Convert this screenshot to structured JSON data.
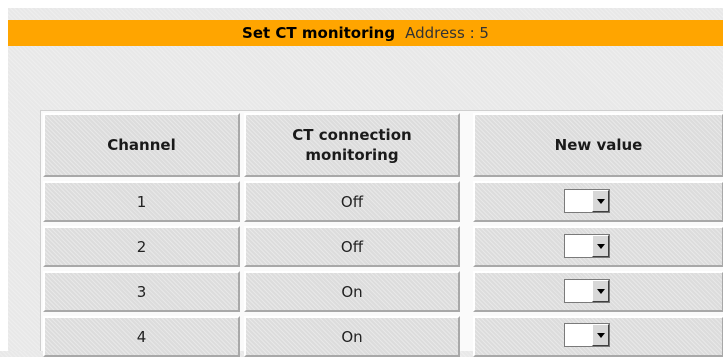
{
  "title_bar": {
    "title": "Set CT monitoring",
    "address": "Address : 5"
  },
  "table": {
    "headers": {
      "channel": "Channel",
      "monitoring": "CT connection monitoring",
      "new_value": "New value"
    },
    "rows": [
      {
        "channel": "1",
        "monitoring": "Off",
        "new_value": ""
      },
      {
        "channel": "2",
        "monitoring": "Off",
        "new_value": ""
      },
      {
        "channel": "3",
        "monitoring": "On",
        "new_value": ""
      },
      {
        "channel": "4",
        "monitoring": "On",
        "new_value": ""
      }
    ]
  },
  "icons": {
    "dropdown": "chevron-down-icon"
  },
  "colors": {
    "title_bar": "#ffa500",
    "cell_background": "#dcdcdc"
  }
}
